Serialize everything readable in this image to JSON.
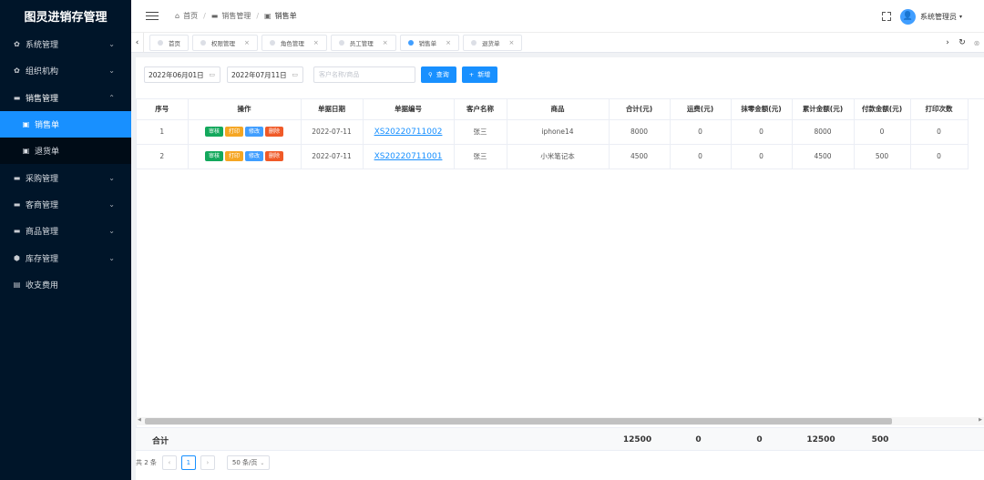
{
  "app": {
    "title": "图灵进销存管理"
  },
  "sidebar": {
    "items": [
      {
        "label": "系统管理",
        "icon": "gear-icon",
        "glyph": "✿",
        "chevron": "⌄"
      },
      {
        "label": "组织机构",
        "icon": "gear-icon",
        "glyph": "✿",
        "chevron": "⌄"
      },
      {
        "label": "销售管理",
        "icon": "folder-icon",
        "glyph": "▬",
        "chevron": "⌃"
      },
      {
        "label": "采购管理",
        "icon": "folder-icon",
        "glyph": "▬",
        "chevron": "⌄"
      },
      {
        "label": "客商管理",
        "icon": "folder-icon",
        "glyph": "▬",
        "chevron": "⌄"
      },
      {
        "label": "商品管理",
        "icon": "folder-icon",
        "glyph": "▬",
        "chevron": "⌄"
      },
      {
        "label": "库存管理",
        "icon": "cube-icon",
        "glyph": "⬢",
        "chevron": "⌄"
      },
      {
        "label": "收支费用",
        "icon": "document-icon",
        "glyph": "▤"
      }
    ],
    "sub_items": [
      {
        "label": "销售单",
        "glyph": "▣"
      },
      {
        "label": "退货单",
        "glyph": "▣"
      }
    ]
  },
  "header": {
    "breadcrumb": [
      {
        "label": "首页",
        "glyph": "⌂"
      },
      {
        "label": "销售管理",
        "glyph": "▬"
      },
      {
        "label": "销售单",
        "glyph": "▣"
      }
    ],
    "separator": "/",
    "username": "系统管理员",
    "avatar_glyph": "👤",
    "caret": "▾"
  },
  "tabs": [
    {
      "label": "首页",
      "closable": false
    },
    {
      "label": "权限管理",
      "closable": true
    },
    {
      "label": "角色管理",
      "closable": true
    },
    {
      "label": "员工管理",
      "closable": true
    },
    {
      "label": "销售单",
      "closable": true,
      "active": true
    },
    {
      "label": "退货单",
      "closable": true
    }
  ],
  "tab_controls": {
    "left": "‹",
    "right": "›",
    "refresh": "↻",
    "close_all": "⊗",
    "close": "×"
  },
  "filters": {
    "start_date": "2022年06月01日",
    "end_date": "2022年07月11日",
    "calendar_glyph": "▭",
    "search_placeholder": "客户名称/商品",
    "search_button": "查询",
    "search_glyph": "⚲",
    "add_button": "新增",
    "add_glyph": "+"
  },
  "table": {
    "columns": [
      "序号",
      "操作",
      "单据日期",
      "单据编号",
      "客户名称",
      "商品",
      "合计(元)",
      "运费(元)",
      "抹零金额(元)",
      "累计金额(元)",
      "付款金额(元)",
      "打印次数"
    ],
    "actions": [
      "审核",
      "打印",
      "修改",
      "删除"
    ],
    "rows": [
      {
        "index": "1",
        "date": "2022-07-11",
        "doc_no": "XS20220711002",
        "customer": "张三",
        "product": "iphone14",
        "total": "8000",
        "freight": "0",
        "round_off": "0",
        "cumulative": "8000",
        "paid": "0",
        "print_count": "0"
      },
      {
        "index": "2",
        "date": "2022-07-11",
        "doc_no": "XS20220711001",
        "customer": "张三",
        "product": "小米笔记本",
        "total": "4500",
        "freight": "0",
        "round_off": "0",
        "cumulative": "4500",
        "paid": "500",
        "print_count": "0"
      }
    ],
    "summary": {
      "label": "合计",
      "total": "12500",
      "freight": "0",
      "round_off": "0",
      "cumulative": "12500",
      "paid": "500"
    }
  },
  "pagination": {
    "total_text": "共 2 条",
    "prev": "‹",
    "next": "›",
    "current_page": "1",
    "page_size": "50 条/页",
    "caret": "⌄"
  },
  "colors": {
    "sidebar_bg": "#001529",
    "active": "#1890ff",
    "audit": "#13a85c",
    "print": "#f5a623",
    "edit": "#409eff",
    "delete": "#f05a28"
  }
}
